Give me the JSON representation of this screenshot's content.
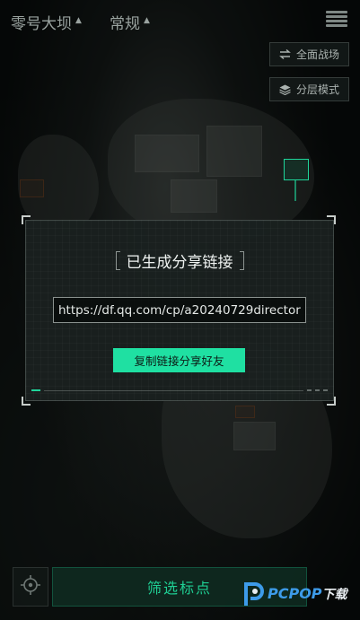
{
  "topbar": {
    "map_selector": "零号大坝",
    "mode_selector": "常规"
  },
  "side_buttons": {
    "full_battlefield": "全面战场",
    "layer_mode": "分层模式"
  },
  "dialog": {
    "title": "已生成分享链接",
    "url": "https://df.qq.com/cp/a20240729director",
    "copy_button": "复制链接分享好友"
  },
  "bottom": {
    "filter_button": "筛选标点"
  },
  "watermark": {
    "brand": "PCPOP",
    "suffix": "下载"
  },
  "colors": {
    "accent": "#1fe0a2",
    "dialog_bg": "#1a201f"
  },
  "icons": [
    "menu-icon",
    "swap-icon",
    "layers-icon",
    "crosshair-icon"
  ]
}
